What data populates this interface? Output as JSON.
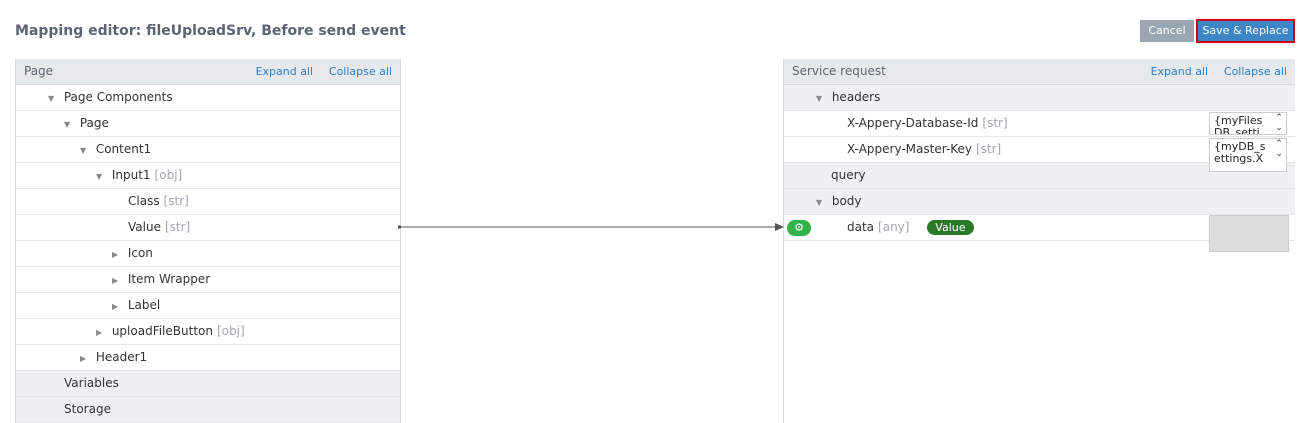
{
  "header": {
    "title": "Mapping editor: fileUploadSrv, Before send event",
    "cancel_label": "Cancel",
    "save_label": "Save & Replace"
  },
  "left_panel": {
    "title": "Page",
    "expand_all": "Expand all",
    "collapse_all": "Collapse all",
    "rows": [
      {
        "label": "Page Components",
        "type": "",
        "arrow": "down"
      },
      {
        "label": "Page",
        "type": "",
        "arrow": "down"
      },
      {
        "label": "Content1",
        "type": "",
        "arrow": "down"
      },
      {
        "label": "Input1",
        "type": "[obj]",
        "arrow": "down"
      },
      {
        "label": "Class",
        "type": "[str]",
        "arrow": ""
      },
      {
        "label": "Value",
        "type": "[str]",
        "arrow": ""
      },
      {
        "label": "Icon",
        "type": "",
        "arrow": "right"
      },
      {
        "label": "Item Wrapper",
        "type": "",
        "arrow": "right"
      },
      {
        "label": "Label",
        "type": "",
        "arrow": "right"
      },
      {
        "label": "uploadFileButton",
        "type": "[obj]",
        "arrow": "right"
      },
      {
        "label": "Header1",
        "type": "",
        "arrow": "right"
      },
      {
        "label": "Variables",
        "type": "",
        "arrow": ""
      },
      {
        "label": "Storage",
        "type": "",
        "arrow": ""
      }
    ]
  },
  "right_panel": {
    "title": "Service request",
    "expand_all": "Expand all",
    "collapse_all": "Collapse all",
    "rows": [
      {
        "label": "headers",
        "type": "",
        "arrow": "down"
      },
      {
        "label": "X-Appery-Database-Id",
        "type": "[str]",
        "arrow": ""
      },
      {
        "label": "X-Appery-Master-Key",
        "type": "[str]",
        "arrow": ""
      },
      {
        "label": "query",
        "type": "",
        "arrow": ""
      },
      {
        "label": "body",
        "type": "",
        "arrow": "down"
      },
      {
        "label": "data",
        "type": "[any]",
        "arrow": ""
      }
    ],
    "value_badge": "Value",
    "db_id_value_line1": "{myFiles",
    "db_id_value_line2": "DB_setti",
    "master_key_value_line1": "{myDB_s",
    "master_key_value_line2": "ettings.X"
  },
  "icons": {
    "gear": "gear-icon",
    "expand": "triangle-down-icon",
    "collapse": "triangle-right-icon"
  },
  "colors": {
    "save_border": "#d0021b",
    "save_bg": "#3d86c6",
    "link": "#2f7dc2",
    "badge": "#2a7a2a",
    "gear": "#2fb34a"
  }
}
